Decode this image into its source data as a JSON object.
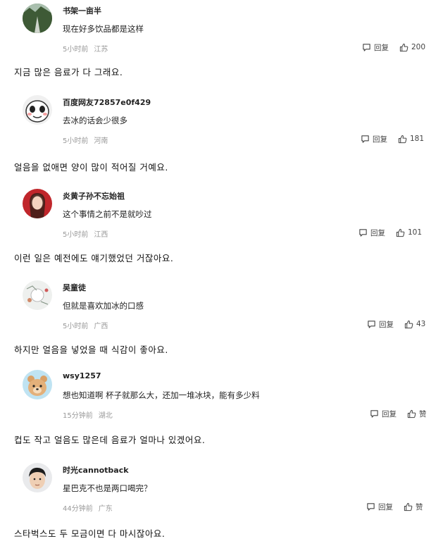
{
  "comments": [
    {
      "username": "书架一亩半",
      "text": "现在好多饮品都是这样",
      "time": "5小时前",
      "location": "江苏",
      "reply_label": "回复",
      "likes": "200",
      "translation": "지금 많은 음료가 다 그래요."
    },
    {
      "username": "百度网友72857e0f429",
      "text": "去冰的话会少很多",
      "time": "5小时前",
      "location": "河南",
      "reply_label": "回复",
      "likes": "181",
      "translation": "얼음을 없애면 양이 많이 적어질 거예요."
    },
    {
      "username": "炎黄子孙不忘始祖",
      "text": "这个事情之前不是就吵过",
      "time": "5小时前",
      "location": "江西",
      "reply_label": "回复",
      "likes": "101",
      "translation": "이런 일은 예전에도 얘기했었던 거잖아요."
    },
    {
      "username": "吴童徒",
      "text": "但就是喜欢加冰的口感",
      "time": "5小时前",
      "location": "广西",
      "reply_label": "回复",
      "likes": "43",
      "translation": "하지만 얼음을 넣었을 때 식감이 좋아요."
    },
    {
      "username": "wsy1257",
      "text": "想也知道啊 杯子就那么大，还加一堆冰块，能有多少料",
      "time": "15分钟前",
      "location": "湖北",
      "reply_label": "回复",
      "likes": "赞",
      "translation": "컵도 작고 얼음도 많은데 음료가 얼마나 있겠어요."
    },
    {
      "username": "时光cannotback",
      "text": "星巴克不也是两口喝完？",
      "time": "44分钟前",
      "location": "广东",
      "reply_label": "回复",
      "likes": "赞",
      "translation": "스타벅스도 두 모금이면 다 마시잖아요."
    }
  ],
  "icons": {
    "reply": "comment-bubble-icon",
    "like": "thumbs-up-icon"
  },
  "colors": {
    "meta": "#999999",
    "text": "#222222"
  }
}
